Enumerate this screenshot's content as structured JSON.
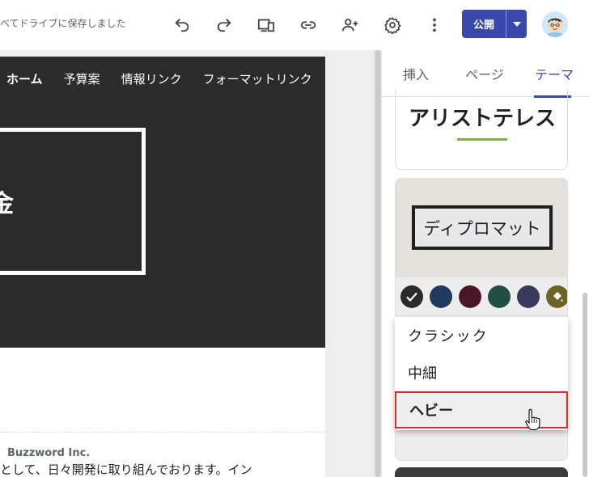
{
  "header": {
    "save_status": "べてドライブに保存しました",
    "publish_label": "公開"
  },
  "site": {
    "nav_items": [
      "ホーム",
      "予算案",
      "情報リンク",
      "フォーマットリンク"
    ],
    "hero_glyph": "金",
    "company": "Buzzword Inc.",
    "body_text": "として、日々開発に取り組んでおります。イン"
  },
  "panel": {
    "tabs": [
      "挿入",
      "ページ",
      "テーマ"
    ],
    "active_tab": "テーマ",
    "themes": {
      "aristotle": "アリストテレス",
      "diplomat": "ディプロマット"
    },
    "swatches": [
      {
        "name": "charcoal",
        "color": "#2b2b2b",
        "selected": true
      },
      {
        "name": "navy",
        "color": "#1f3a5f",
        "selected": false
      },
      {
        "name": "maroon",
        "color": "#4a1628",
        "selected": false
      },
      {
        "name": "forest-green",
        "color": "#214f45",
        "selected": false
      },
      {
        "name": "slate-indigo",
        "color": "#373a5c",
        "selected": false
      },
      {
        "name": "custom-olive",
        "color": "#6b6424",
        "selected": false
      }
    ],
    "font_options": [
      "クラシック",
      "中細",
      "ヘビー"
    ],
    "selected_font": "ヘビー"
  },
  "colors": {
    "accent": "#3949ab",
    "highlight_border": "#d32f2f",
    "underline_green": "#7cb342"
  }
}
